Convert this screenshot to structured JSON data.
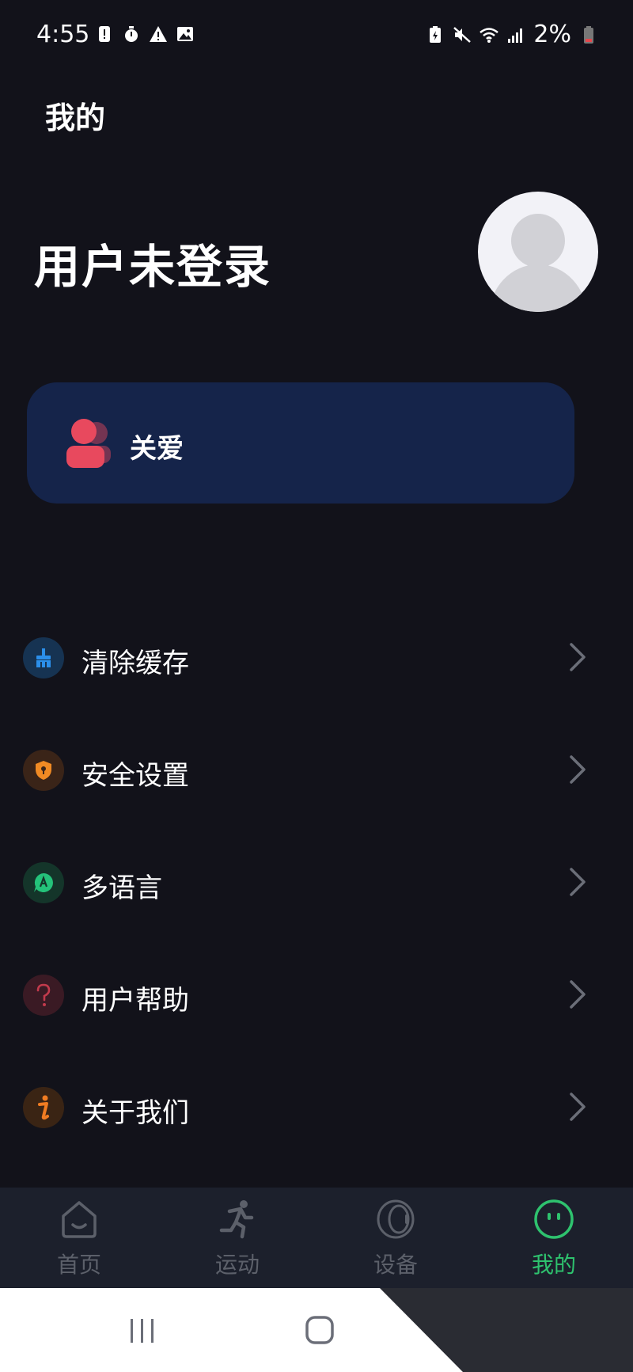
{
  "status_bar": {
    "time": "4:55",
    "left_icons": [
      "alert-badge-icon",
      "stopwatch-icon",
      "warning-icon",
      "image-icon"
    ],
    "right_icons": [
      "battery-saver-icon",
      "mute-icon",
      "wifi-icon",
      "signal-icon",
      "battery-low-icon"
    ],
    "battery_text": "2%"
  },
  "header": {
    "title": "我的"
  },
  "profile": {
    "name": "用户未登录",
    "avatar_icon": "default-avatar"
  },
  "care_card": {
    "label": "关爱",
    "icon": "care-people-icon",
    "icon_color": "#e8495e",
    "background": "#15244a"
  },
  "menu": {
    "items": [
      {
        "label": "清除缓存",
        "icon": "broom-icon",
        "icon_color": "#2b8fea",
        "icon_bg": "#163352"
      },
      {
        "label": "安全设置",
        "icon": "shield-icon",
        "icon_color": "#f08a24",
        "icon_bg": "#3a2418"
      },
      {
        "label": "多语言",
        "icon": "language-icon",
        "icon_color": "#24c27a",
        "icon_bg": "#14352a"
      },
      {
        "label": "用户帮助",
        "icon": "help-icon",
        "icon_color": "#c23a4c",
        "icon_bg": "#3a1a24"
      },
      {
        "label": "关于我们",
        "icon": "info-icon",
        "icon_color": "#f07c22",
        "icon_bg": "#3a2414"
      }
    ]
  },
  "bottom_nav": {
    "tabs": [
      {
        "label": "首页",
        "icon": "home-icon",
        "active": false
      },
      {
        "label": "运动",
        "icon": "running-icon",
        "active": false
      },
      {
        "label": "设备",
        "icon": "ring-device-icon",
        "active": false
      },
      {
        "label": "我的",
        "icon": "smiley-face-icon",
        "active": true
      }
    ],
    "active_color": "#2ec26e",
    "inactive_color": "#5c606a"
  },
  "system_nav": {
    "buttons": [
      "recent-apps-icon",
      "home-button-icon"
    ]
  }
}
